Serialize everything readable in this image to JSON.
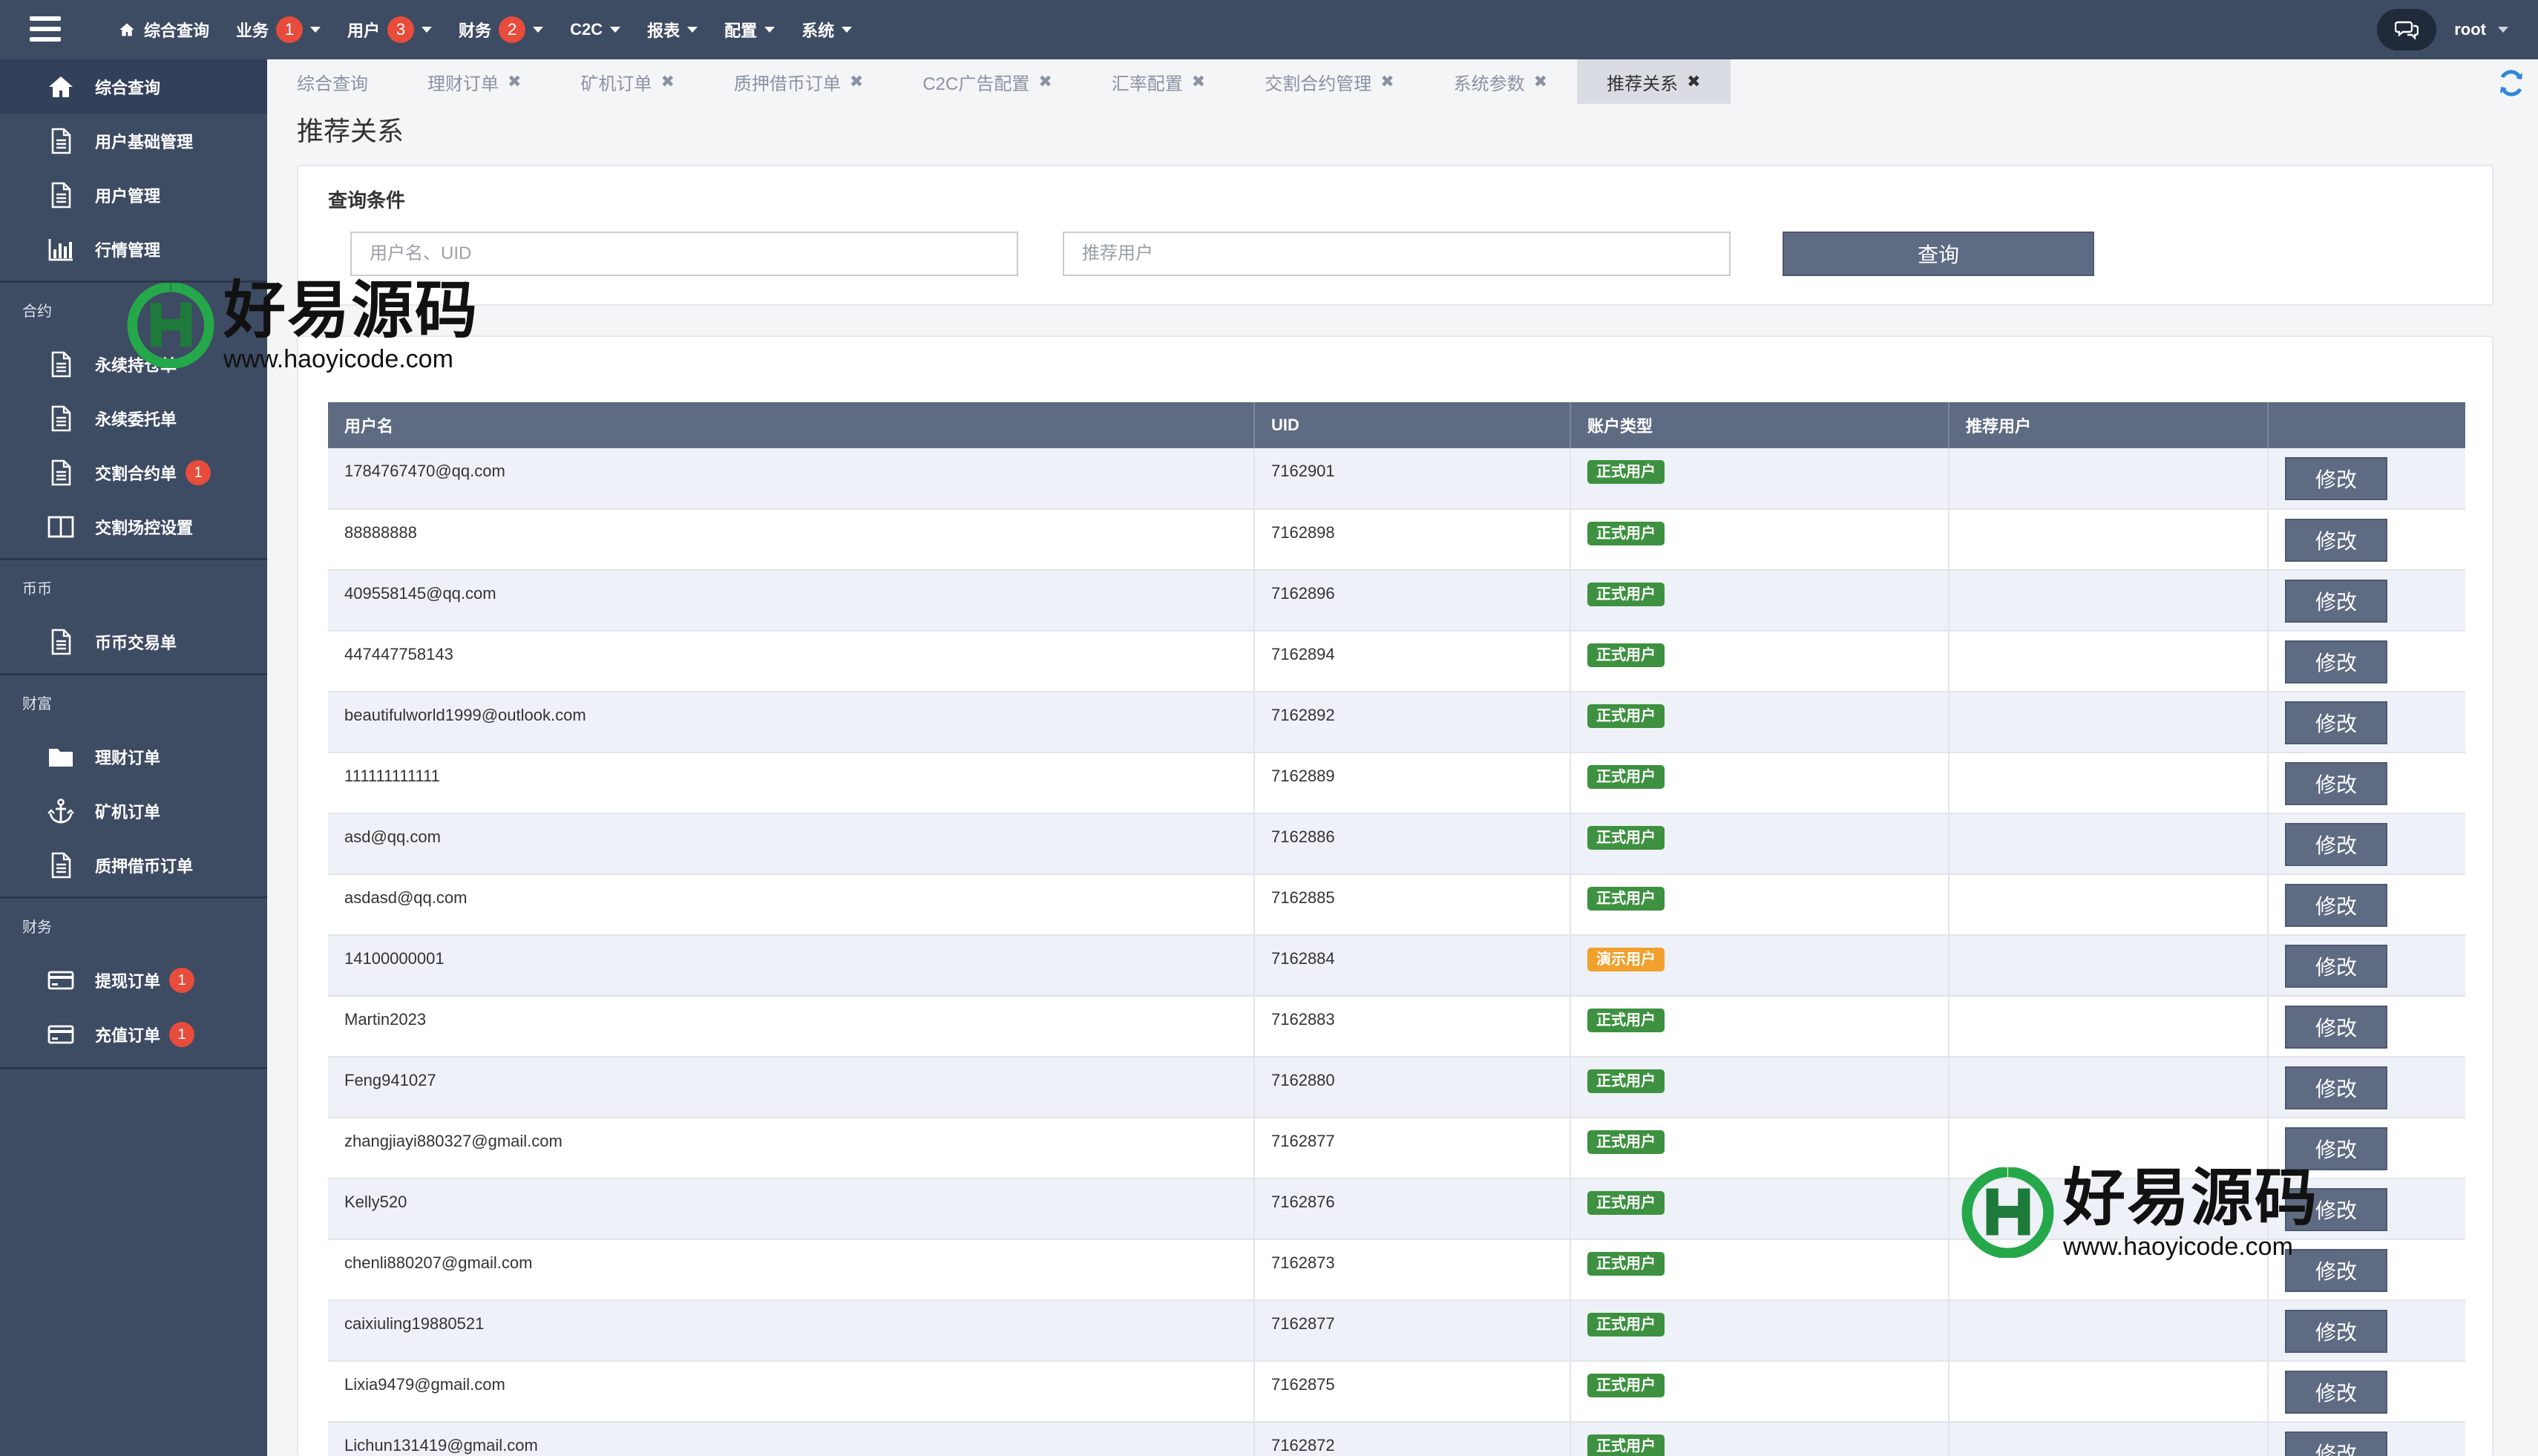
{
  "topbar": {
    "nav": [
      {
        "label": "综合查询",
        "badge": null,
        "dropdown": false,
        "icon": "home-icon"
      },
      {
        "label": "业务",
        "badge": "1",
        "dropdown": true
      },
      {
        "label": "用户",
        "badge": "3",
        "dropdown": true
      },
      {
        "label": "财务",
        "badge": "2",
        "dropdown": true
      },
      {
        "label": "C2C",
        "badge": null,
        "dropdown": true
      },
      {
        "label": "报表",
        "badge": null,
        "dropdown": true
      },
      {
        "label": "配置",
        "badge": null,
        "dropdown": true
      },
      {
        "label": "系统",
        "badge": null,
        "dropdown": true
      }
    ],
    "user": "root"
  },
  "sidebar": {
    "top_items": [
      {
        "label": "综合查询",
        "icon": "home-icon",
        "active": true
      },
      {
        "label": "用户基础管理",
        "icon": "document-icon"
      },
      {
        "label": "用户管理",
        "icon": "document-icon"
      },
      {
        "label": "行情管理",
        "icon": "bar-chart-icon"
      }
    ],
    "sections": [
      {
        "title": "合约",
        "items": [
          {
            "label": "永续持仓单",
            "icon": "document-icon"
          },
          {
            "label": "永续委托单",
            "icon": "document-icon"
          },
          {
            "label": "交割合约单",
            "icon": "document-icon",
            "badge": "1"
          },
          {
            "label": "交割场控设置",
            "icon": "columns-icon"
          }
        ]
      },
      {
        "title": "币币",
        "items": [
          {
            "label": "币币交易单",
            "icon": "document-icon"
          }
        ]
      },
      {
        "title": "财富",
        "items": [
          {
            "label": "理财订单",
            "icon": "folder-icon"
          },
          {
            "label": "矿机订单",
            "icon": "anchor-icon"
          },
          {
            "label": "质押借币订单",
            "icon": "document-icon"
          }
        ]
      },
      {
        "title": "财务",
        "items": [
          {
            "label": "提现订单",
            "icon": "credit-card-icon",
            "badge": "1"
          },
          {
            "label": "充值订单",
            "icon": "credit-card-icon",
            "badge": "1"
          }
        ]
      }
    ]
  },
  "tabs": [
    {
      "label": "综合查询",
      "closable": false,
      "active": false
    },
    {
      "label": "理财订单",
      "closable": true,
      "active": false
    },
    {
      "label": "矿机订单",
      "closable": true,
      "active": false
    },
    {
      "label": "质押借币订单",
      "closable": true,
      "active": false
    },
    {
      "label": "C2C广告配置",
      "closable": true,
      "active": false
    },
    {
      "label": "汇率配置",
      "closable": true,
      "active": false
    },
    {
      "label": "交割合约管理",
      "closable": true,
      "active": false
    },
    {
      "label": "系统参数",
      "closable": true,
      "active": false
    },
    {
      "label": "推荐关系",
      "closable": true,
      "active": true
    }
  ],
  "tab_close_glyph": "✖",
  "page": {
    "title": "推荐关系"
  },
  "query": {
    "title": "查询条件",
    "user_placeholder": "用户名、UID",
    "referrer_placeholder": "推荐用户",
    "button": "查询"
  },
  "table": {
    "headers": [
      "用户名",
      "UID",
      "账户类型",
      "推荐用户",
      ""
    ],
    "edit_label": "修改",
    "rows": [
      {
        "username": "1784767470@qq.com",
        "uid": "7162901",
        "type": "正式用户",
        "type_kind": "formal",
        "referrer": ""
      },
      {
        "username": "88888888",
        "uid": "7162898",
        "type": "正式用户",
        "type_kind": "formal",
        "referrer": ""
      },
      {
        "username": "409558145@qq.com",
        "uid": "7162896",
        "type": "正式用户",
        "type_kind": "formal",
        "referrer": ""
      },
      {
        "username": "447447758143",
        "uid": "7162894",
        "type": "正式用户",
        "type_kind": "formal",
        "referrer": ""
      },
      {
        "username": "beautifulworld1999@outlook.com",
        "uid": "7162892",
        "type": "正式用户",
        "type_kind": "formal",
        "referrer": ""
      },
      {
        "username": "111111111111",
        "uid": "7162889",
        "type": "正式用户",
        "type_kind": "formal",
        "referrer": ""
      },
      {
        "username": "asd@qq.com",
        "uid": "7162886",
        "type": "正式用户",
        "type_kind": "formal",
        "referrer": ""
      },
      {
        "username": "asdasd@qq.com",
        "uid": "7162885",
        "type": "正式用户",
        "type_kind": "formal",
        "referrer": ""
      },
      {
        "username": "14100000001",
        "uid": "7162884",
        "type": "演示用户",
        "type_kind": "demo",
        "referrer": ""
      },
      {
        "username": "Martin2023",
        "uid": "7162883",
        "type": "正式用户",
        "type_kind": "formal",
        "referrer": ""
      },
      {
        "username": "Feng941027",
        "uid": "7162880",
        "type": "正式用户",
        "type_kind": "formal",
        "referrer": ""
      },
      {
        "username": "zhangjiayi880327@gmail.com",
        "uid": "7162877",
        "type": "正式用户",
        "type_kind": "formal",
        "referrer": ""
      },
      {
        "username": "Kelly520",
        "uid": "7162876",
        "type": "正式用户",
        "type_kind": "formal",
        "referrer": ""
      },
      {
        "username": "chenli880207@gmail.com",
        "uid": "7162873",
        "type": "正式用户",
        "type_kind": "formal",
        "referrer": ""
      },
      {
        "username": "caixiuling19880521",
        "uid": "7162877",
        "type": "正式用户",
        "type_kind": "formal",
        "referrer": ""
      },
      {
        "username": "Lixia9479@gmail.com",
        "uid": "7162875",
        "type": "正式用户",
        "type_kind": "formal",
        "referrer": ""
      },
      {
        "username": "Lichun131419@gmail.com",
        "uid": "7162872",
        "type": "正式用户",
        "type_kind": "formal",
        "referrer": ""
      }
    ]
  },
  "watermark": {
    "brand": "好易源码",
    "url": "www.haoyicode.com"
  },
  "colors": {
    "topbar": "#3d4b63",
    "badge": "#e74c3c",
    "formal_tag": "#3d9140",
    "demo_tag": "#f0a02c",
    "primary_button": "#5e6b82"
  }
}
